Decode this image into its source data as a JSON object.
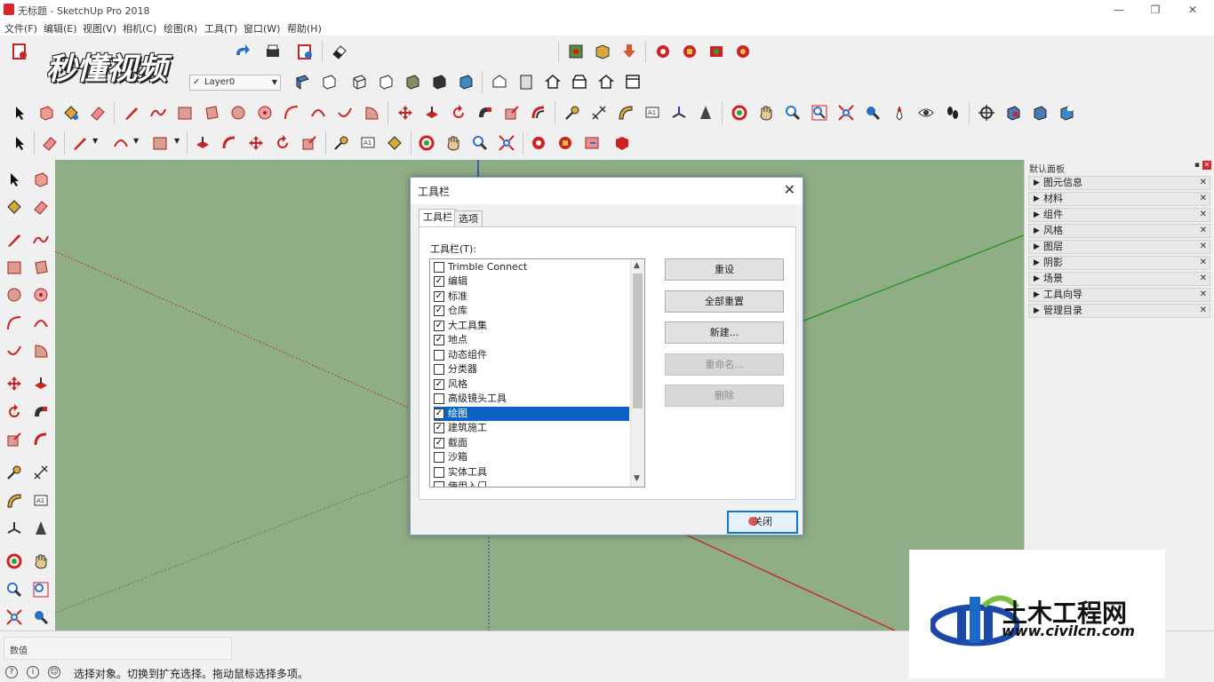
{
  "window": {
    "title": "无标题 - SketchUp Pro 2018",
    "minimize": "—",
    "restore": "❐",
    "close": "✕"
  },
  "menu": [
    "文件(F)",
    "编辑(E)",
    "视图(V)",
    "相机(C)",
    "绘图(R)",
    "工具(T)",
    "窗口(W)",
    "帮助(H)"
  ],
  "watermark_text": "秒懂视频",
  "layer": {
    "name": "Layer0"
  },
  "tray": {
    "title": "默认面板",
    "items": [
      "图元信息",
      "材料",
      "组件",
      "风格",
      "图层",
      "阴影",
      "场景",
      "工具向导",
      "管理目录"
    ]
  },
  "measurements": {
    "label": "数值"
  },
  "status": {
    "message": "选择对象。切换到扩充选择。拖动鼠标选择多项。"
  },
  "dialog": {
    "title": "工具栏",
    "tabs": [
      "工具栏",
      "选项"
    ],
    "list_label": "工具栏(T):",
    "items": [
      {
        "label": "Trimble Connect",
        "checked": false
      },
      {
        "label": "编辑",
        "checked": true
      },
      {
        "label": "标准",
        "checked": true
      },
      {
        "label": "仓库",
        "checked": true
      },
      {
        "label": "大工具集",
        "checked": true
      },
      {
        "label": "地点",
        "checked": true
      },
      {
        "label": "动态组件",
        "checked": false
      },
      {
        "label": "分类器",
        "checked": false
      },
      {
        "label": "风格",
        "checked": true
      },
      {
        "label": "高级镜头工具",
        "checked": false
      },
      {
        "label": "绘图",
        "checked": true,
        "selected": true
      },
      {
        "label": "建筑施工",
        "checked": true
      },
      {
        "label": "截面",
        "checked": true
      },
      {
        "label": "沙箱",
        "checked": false
      },
      {
        "label": "实体工具",
        "checked": false
      },
      {
        "label": "使用入门",
        "checked": false
      }
    ],
    "buttons": {
      "reset": "重设",
      "reset_all": "全部重置",
      "new": "新建...",
      "rename": "重命名...",
      "delete": "删除",
      "close": "关闭"
    }
  },
  "logo": {
    "name": "土木工程网",
    "url": "www.civilcn.com"
  },
  "colors": {
    "viewport_bg": "#8fad86",
    "selection": "#0a64c8",
    "axis_red": "#c0302a",
    "axis_green": "#2a9a2a",
    "axis_blue": "#2a3ac0"
  }
}
